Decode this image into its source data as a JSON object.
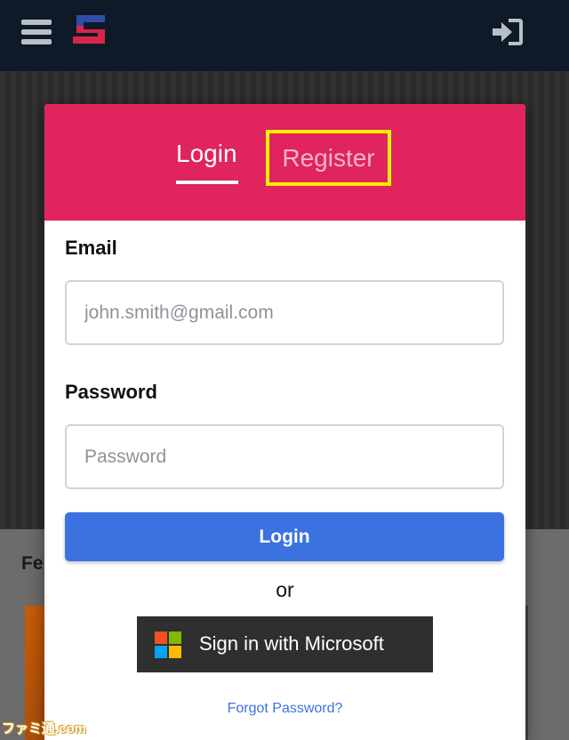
{
  "header": {
    "menu_icon": "hamburger-menu-icon",
    "logo_icon": "site-logo",
    "login_icon": "sign-in-icon"
  },
  "background": {
    "section_heading": "Fe",
    "watermark": "ファミ通.com"
  },
  "modal": {
    "tabs": {
      "login": "Login",
      "register": "Register"
    },
    "active_tab": "login",
    "email_label": "Email",
    "email_placeholder": "john.smith@gmail.com",
    "password_label": "Password",
    "password_placeholder": "Password",
    "login_button": "Login",
    "or_text": "or",
    "microsoft_button": "Sign in with Microsoft",
    "forgot_password": "Forgot Password?"
  },
  "colors": {
    "topbar": "#0f1a28",
    "modal_header": "#e0245e",
    "primary_button": "#3b72e0",
    "highlight_box": "#fff000",
    "microsoft_button": "#2f2f2f"
  }
}
